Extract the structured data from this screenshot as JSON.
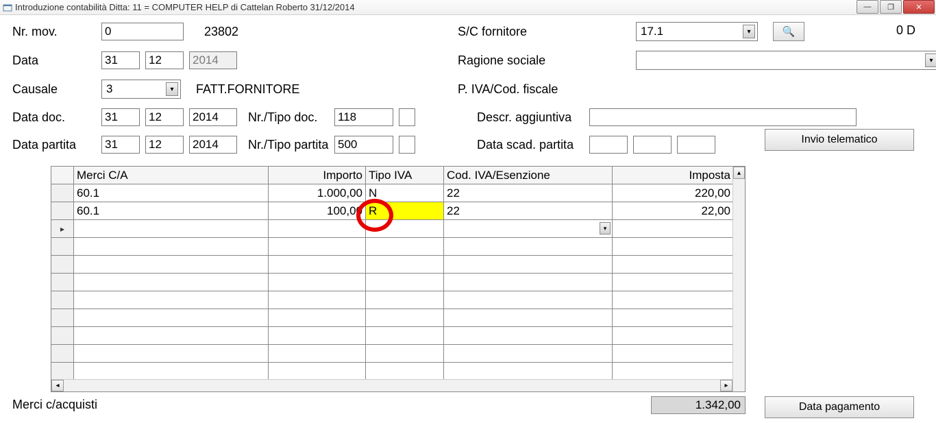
{
  "window": {
    "title": "Introduzione contabilità  Ditta: 11 = COMPUTER HELP di Cattelan Roberto  31/12/2014"
  },
  "labels": {
    "nr_mov": "Nr. mov.",
    "data": "Data",
    "causale": "Causale",
    "data_doc": "Data doc.",
    "data_partita": "Data partita",
    "causale_descr": "FATT.FORNITORE",
    "nr_tipo_doc": "Nr./Tipo doc.",
    "nr_tipo_partita": "Nr./Tipo partita",
    "sc_fornitore": "S/C fornitore",
    "ragione_sociale": "Ragione sociale",
    "piva": "P. IVA/Cod. fiscale",
    "descr_aggiuntiva": "Descr. aggiuntiva",
    "data_scad": "Data scad. partita",
    "invio": "Invio telematico",
    "data_pag": "Data pagamento"
  },
  "fields": {
    "nr_mov": "0",
    "nr_mov_seq": "23802",
    "data_d": "31",
    "data_m": "12",
    "data_y": "2014",
    "causale": "3",
    "doc_d": "31",
    "doc_m": "12",
    "doc_y": "2014",
    "partita_d": "31",
    "partita_m": "12",
    "partita_y": "2014",
    "nr_doc": "118",
    "nr_partita": "500",
    "sc_fornitore": "17.1",
    "ragione_sociale": "",
    "descr_aggiuntiva": "",
    "scad_d": "",
    "scad_m": "",
    "scad_y": ""
  },
  "status": "0 D",
  "grid": {
    "headers": {
      "merci": "Merci C/A",
      "importo": "Importo",
      "tipo_iva": "Tipo IVA",
      "cod_iva": "Cod. IVA/Esenzione",
      "imposta": "Imposta"
    },
    "rows": [
      {
        "merci": "60.1",
        "importo": "1.000,00",
        "tipo": "N",
        "cod": "22",
        "imposta": "220,00"
      },
      {
        "merci": "60.1",
        "importo": "100,00",
        "tipo": "R",
        "cod": "22",
        "imposta": "22,00"
      }
    ],
    "total": "1.342,00"
  },
  "footer": {
    "descr": "Merci c/acquisti"
  }
}
